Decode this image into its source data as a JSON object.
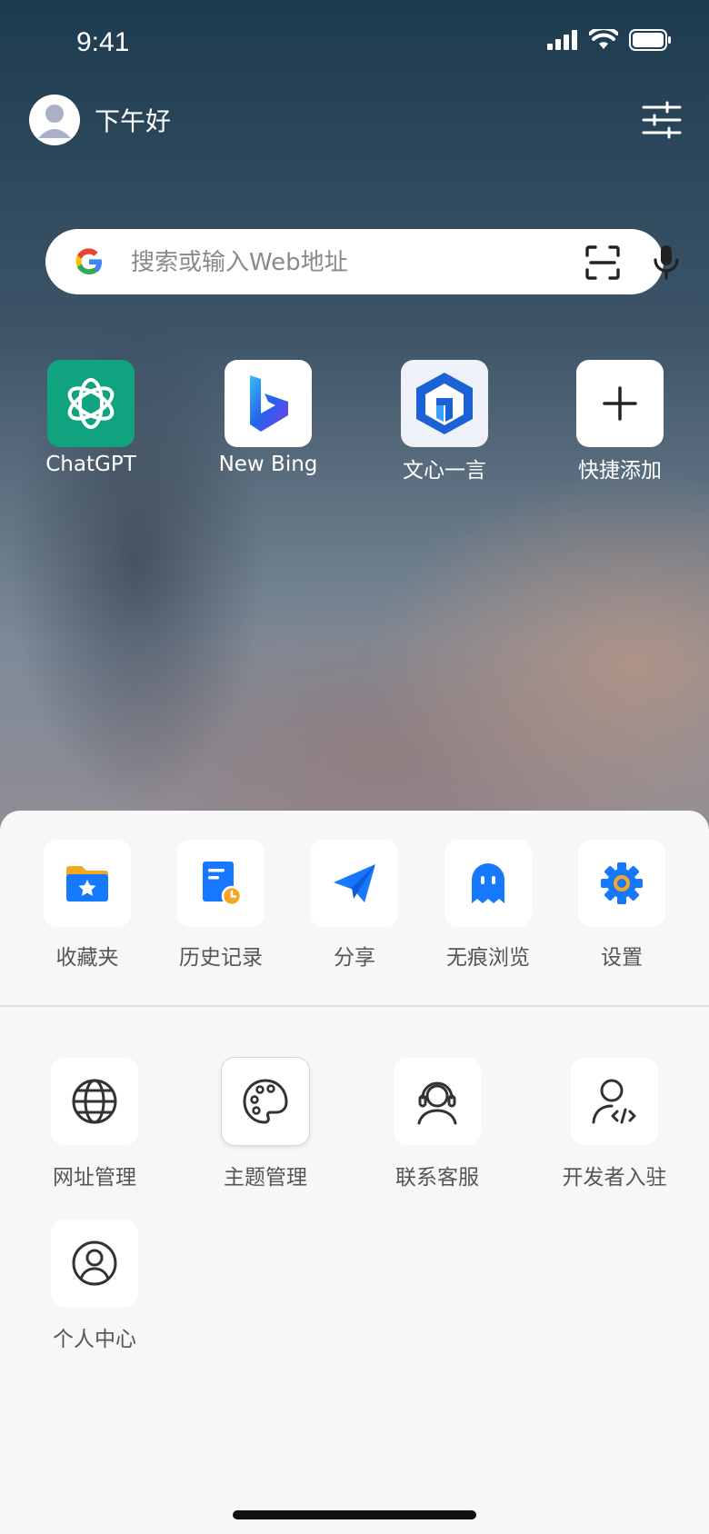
{
  "status": {
    "time": "9:41"
  },
  "header": {
    "greeting": "下午好"
  },
  "search": {
    "placeholder": "搜索或输入Web地址"
  },
  "shortcuts": [
    {
      "label": "ChatGPT",
      "icon": "chatgpt-logo-icon",
      "bg": "#10a37f"
    },
    {
      "label": "New Bing",
      "icon": "bing-logo-icon",
      "bg": "#ffffff"
    },
    {
      "label": "文心一言",
      "icon": "wenxin-logo-icon",
      "bg": "#f0f3f8"
    },
    {
      "label": "快捷添加",
      "icon": "plus-icon",
      "bg": "#ffffff"
    }
  ],
  "actions": [
    {
      "label": "收藏夹",
      "icon": "favorites-folder-icon"
    },
    {
      "label": "历史记录",
      "icon": "history-icon"
    },
    {
      "label": "分享",
      "icon": "share-plane-icon"
    },
    {
      "label": "无痕浏览",
      "icon": "ghost-icon"
    },
    {
      "label": "设置",
      "icon": "gear-icon"
    }
  ],
  "tools": [
    {
      "label": "网址管理",
      "icon": "globe-icon"
    },
    {
      "label": "主题管理",
      "icon": "palette-icon"
    },
    {
      "label": "联系客服",
      "icon": "headset-icon"
    },
    {
      "label": "开发者入驻",
      "icon": "developer-icon"
    },
    {
      "label": "个人中心",
      "icon": "user-circle-icon"
    }
  ],
  "colors": {
    "accent": "#1677ff",
    "orange": "#f5a623"
  }
}
